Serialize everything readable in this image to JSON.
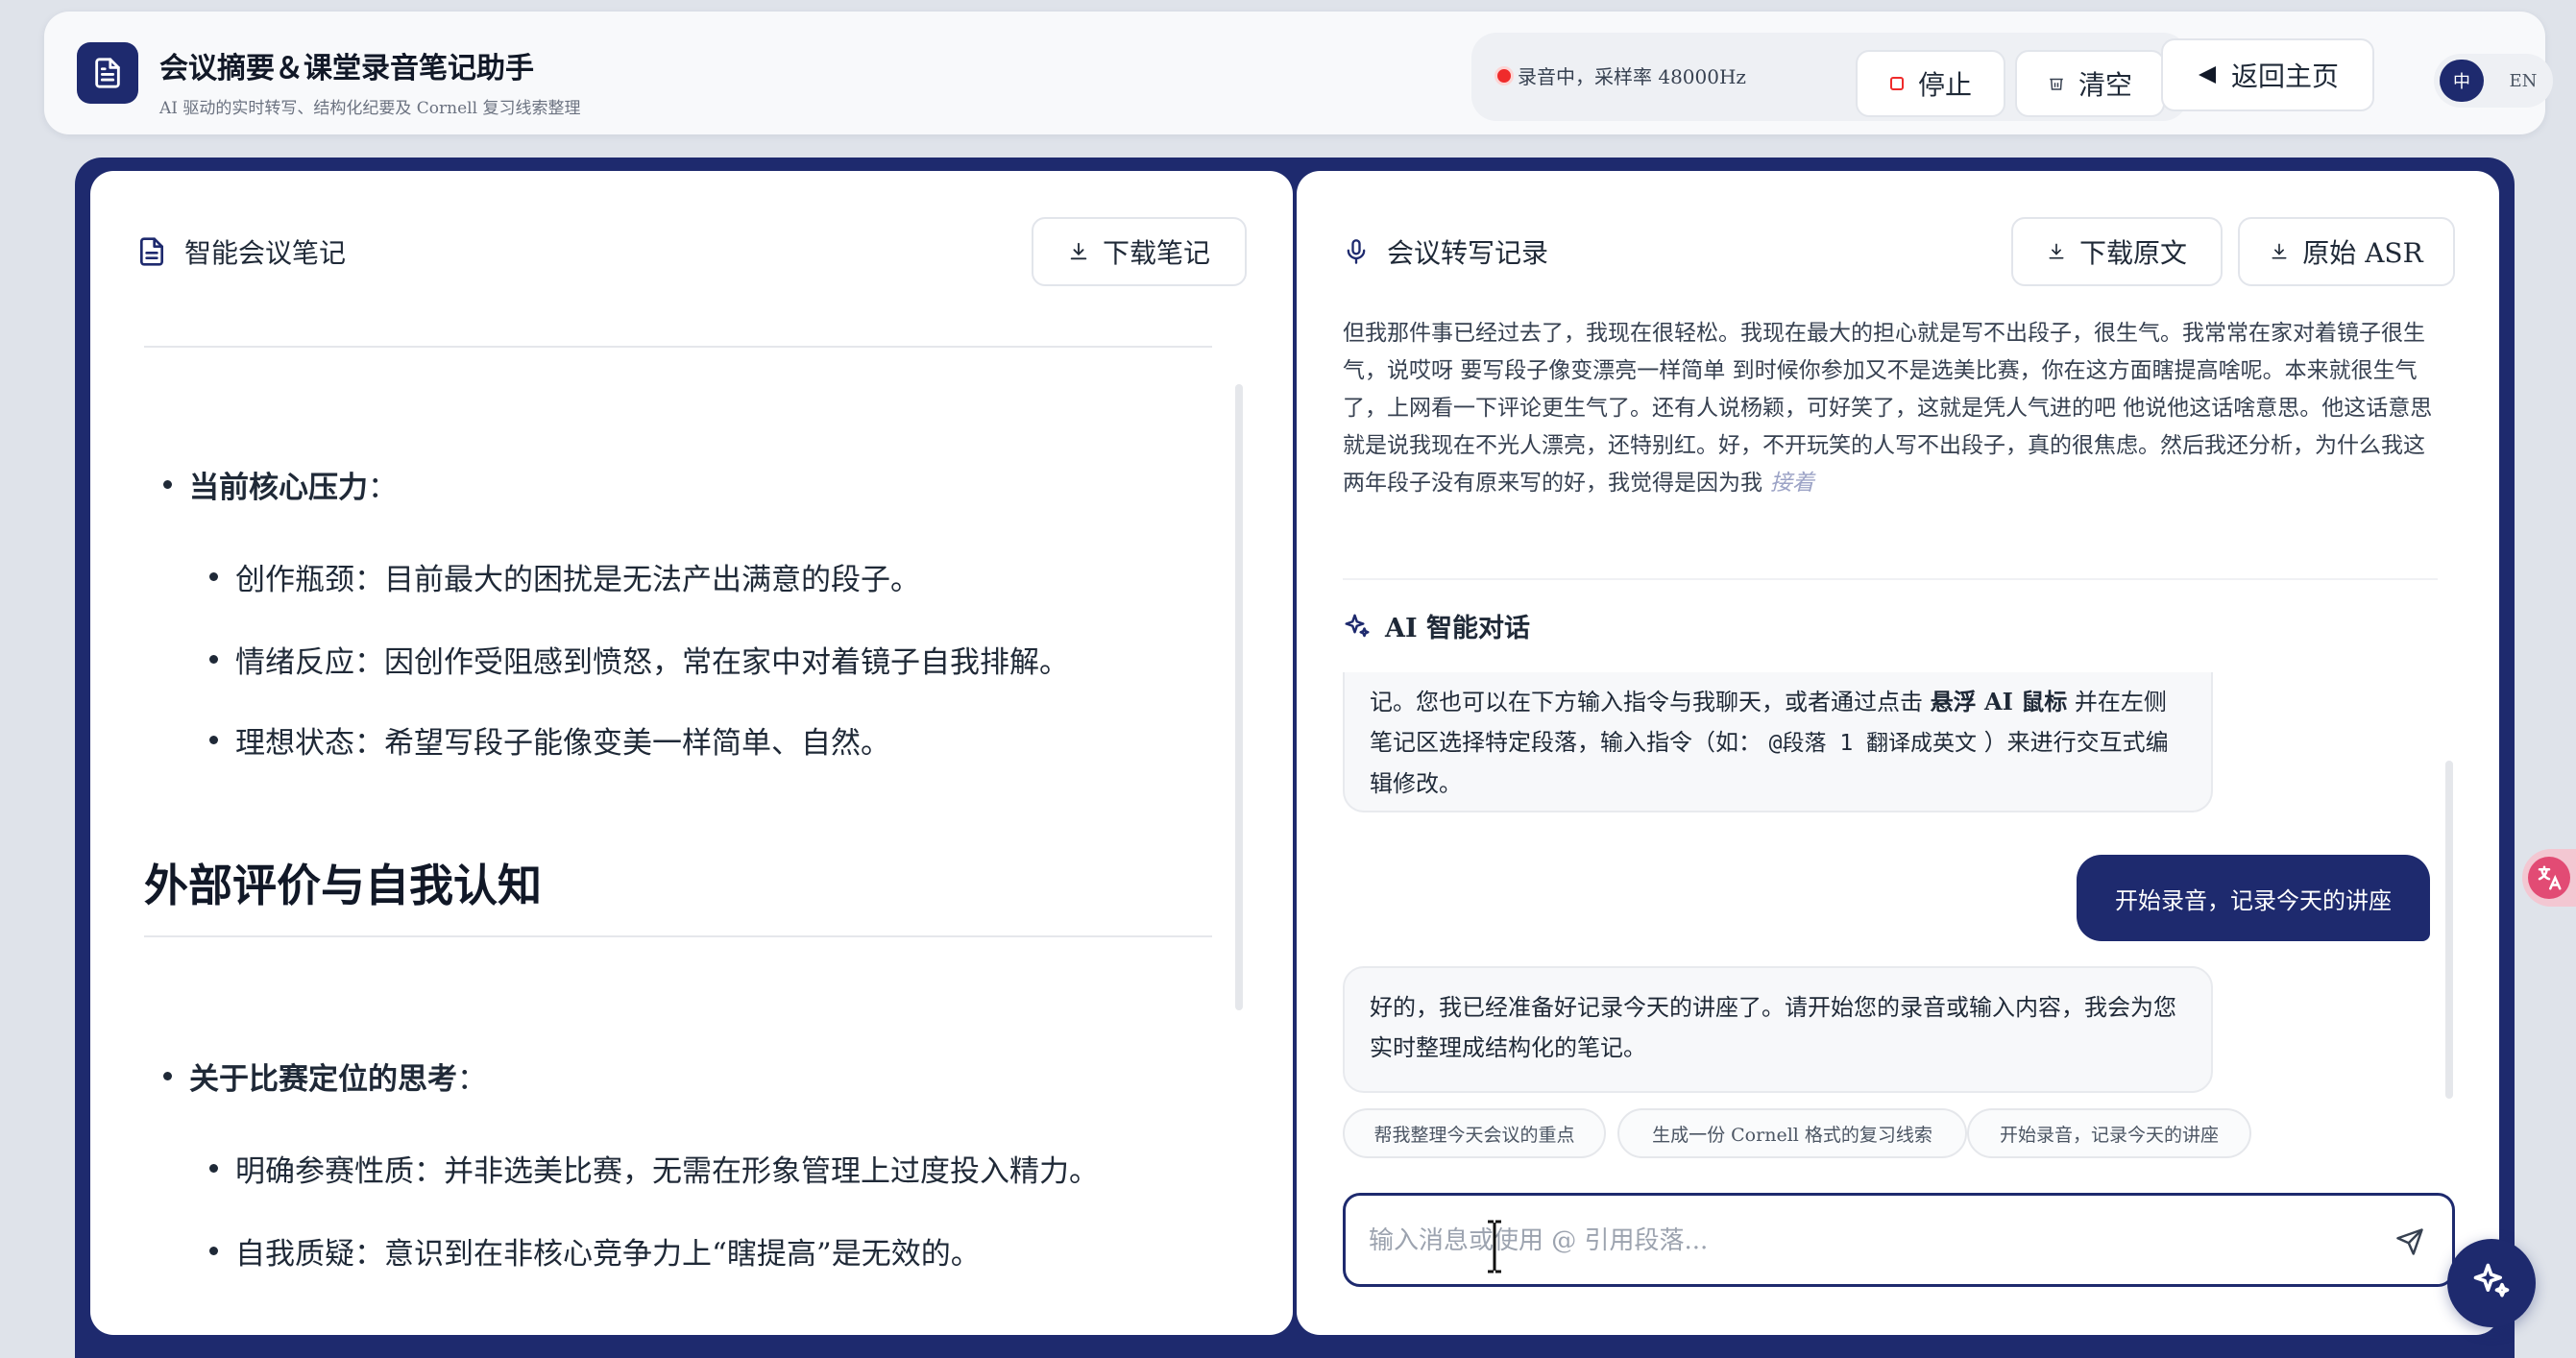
{
  "app": {
    "title": "会议摘要＆课堂录音笔记助手",
    "subtitle": "AI 驱动的实时转写、结构化纪要及 Cornell 复习线索整理",
    "icon": "document-icon"
  },
  "recording": {
    "status_text": "录音中，采样率 48000Hz",
    "stop_label": "停止",
    "clear_label": "清空",
    "back_label": "返回主页"
  },
  "language": {
    "zh": "中",
    "en": "EN",
    "selected": "中"
  },
  "notes_panel": {
    "title": "智能会议笔记",
    "download_label": "下载笔记",
    "items": [
      {
        "heading": "当前核心压力",
        "colon": "："
      },
      {
        "text": "创作瓶颈：目前最大的困扰是无法产出满意的段子。"
      },
      {
        "text": "情绪反应：因创作受阻感到愤怒，常在家中对着镜子自我排解。"
      },
      {
        "text": "理想状态：希望写段子能像变美一样简单、自然。"
      },
      {
        "section": "外部评价与自我认知"
      },
      {
        "heading": "关于比赛定位的思考",
        "colon": "："
      },
      {
        "text": "明确参赛性质：并非选美比赛，无需在形象管理上过度投入精力。"
      },
      {
        "text": "自我质疑：意识到在非核心竞争力上“瞎提高”是无效的。"
      }
    ]
  },
  "transcript_panel": {
    "title": "会议转写记录",
    "download_label": "下载原文",
    "raw_label": "原始 ASR",
    "text": "但我那件事已经过去了，我现在很轻松。我现在最大的担心就是写不出段子，很生气。我常常在家对着镜子很生气，说哎呀 要写段子像变漂亮一样简单 到时候你参加又不是选美比赛，你在这方面瞎提高啥呢。本来就很生气了，上网看一下评论更生气了。还有人说杨颖，可好笑了，这就是凭人气进的吧 他说他这话啥意思。他这话意思就是说我现在不光人漂亮，还特别红。好，不开玩笑的人写不出段子，真的很焦虑。然后我还分析，为什么我这两年段子没有原来写的好，我觉得是因为我",
    "more_label": "接着"
  },
  "chat": {
    "title": "AI 智能对话",
    "ai_msg_1": {
      "part1": "记。您也可以在下方输入指令与我聊天，或者通过点击",
      "bold": "悬浮 AI 鼠标",
      "part2": "并在左侧笔记区选择特定段落，输入指令（如：",
      "code": "@段落 1 翻译成英文",
      "part3": "）来进行交互式编辑修改。"
    },
    "user_msg": "开始录音，记录今天的讲座",
    "ai_msg_2": "好的，我已经准备好记录今天的讲座了。请开始您的录音或输入内容，我会为您实时整理成结构化的笔记。",
    "suggestions": [
      "帮我整理今天会议的重点",
      "生成一份 Cornell 格式的复习线索",
      "开始录音，记录今天的讲座"
    ],
    "input_placeholder": "输入消息或使用 @ 引用段落...",
    "input_value": ""
  },
  "colors": {
    "brand": "#1e2a6e",
    "recording": "#ef2b2b",
    "background": "#dfe3ea"
  }
}
